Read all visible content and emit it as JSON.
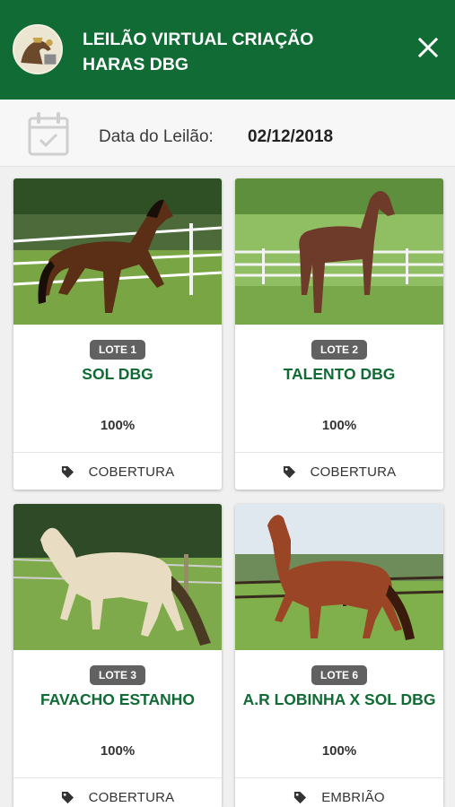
{
  "header": {
    "title_line1": "LEILÃO VIRTUAL CRIAÇÃO",
    "title_line2": "HARAS DBG",
    "avatar_icon": "haras-logo-avatar",
    "close_icon": "close-icon"
  },
  "date_bar": {
    "label": "Data do Leilão:",
    "value": "02/12/2018",
    "icon": "calendar-check-icon"
  },
  "lots": [
    {
      "lot_label": "LOTE 1",
      "name": "SOL DBG",
      "percent": "100%",
      "type": "COBERTURA"
    },
    {
      "lot_label": "LOTE 2",
      "name": "TALENTO DBG",
      "percent": "100%",
      "type": "COBERTURA"
    },
    {
      "lot_label": "LOTE 3",
      "name": "FAVACHO ESTANHO",
      "percent": "100%",
      "type": "COBERTURA"
    },
    {
      "lot_label": "LOTE 6",
      "name": "A.R LOBINHA X SOL DBG",
      "percent": "100%",
      "type": "EMBRIÃO"
    }
  ],
  "colors": {
    "primary_green": "#106b34",
    "lot_badge": "#616161",
    "page_background": "#f0f0f0"
  }
}
